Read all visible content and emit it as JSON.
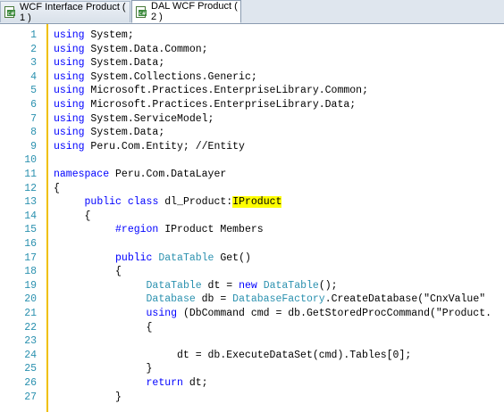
{
  "tabs": [
    {
      "label": "WCF Interface Product ( 1 )"
    },
    {
      "label": "DAL WCF Product ( 2 )"
    }
  ],
  "colors": {
    "keyword": "#0000ff",
    "type": "#2b91af",
    "highlight": "#ffff00",
    "line_number": "#2b91af",
    "margin": "#f0c000"
  },
  "lines": [
    {
      "num": "1",
      "t": [
        {
          "k": "kw",
          "s": "using"
        },
        {
          "s": " System;"
        }
      ]
    },
    {
      "num": "2",
      "t": [
        {
          "k": "kw",
          "s": "using"
        },
        {
          "s": " System.Data.Common;"
        }
      ]
    },
    {
      "num": "3",
      "t": [
        {
          "k": "kw",
          "s": "using"
        },
        {
          "s": " System.Data;"
        }
      ]
    },
    {
      "num": "4",
      "t": [
        {
          "k": "kw",
          "s": "using"
        },
        {
          "s": " System.Collections.Generic;"
        }
      ]
    },
    {
      "num": "5",
      "t": [
        {
          "k": "kw",
          "s": "using"
        },
        {
          "s": " Microsoft.Practices.EnterpriseLibrary.Common;"
        }
      ]
    },
    {
      "num": "6",
      "t": [
        {
          "k": "kw",
          "s": "using"
        },
        {
          "s": " Microsoft.Practices.EnterpriseLibrary.Data;"
        }
      ]
    },
    {
      "num": "7",
      "t": [
        {
          "k": "kw",
          "s": "using"
        },
        {
          "s": " System.ServiceModel;"
        }
      ]
    },
    {
      "num": "8",
      "t": [
        {
          "k": "kw",
          "s": "using"
        },
        {
          "s": " System.Data;"
        }
      ]
    },
    {
      "num": "9",
      "t": [
        {
          "k": "kw",
          "s": "using"
        },
        {
          "s": " Peru.Com.Entity; //Entity"
        }
      ]
    },
    {
      "num": "10",
      "t": []
    },
    {
      "num": "11",
      "t": [
        {
          "k": "kw",
          "s": "namespace"
        },
        {
          "s": " Peru.Com.DataLayer"
        }
      ]
    },
    {
      "num": "12",
      "t": [
        {
          "s": "{"
        }
      ]
    },
    {
      "num": "13",
      "t": [
        {
          "s": "     "
        },
        {
          "k": "kw",
          "s": "public"
        },
        {
          "s": " "
        },
        {
          "k": "kw",
          "s": "class"
        },
        {
          "s": " dl_Product:"
        },
        {
          "k": "hl",
          "s": "IProduct"
        }
      ]
    },
    {
      "num": "14",
      "t": [
        {
          "s": "     {"
        }
      ]
    },
    {
      "num": "15",
      "t": [
        {
          "s": "          "
        },
        {
          "k": "kw",
          "s": "#region"
        },
        {
          "s": " IProduct Members"
        }
      ]
    },
    {
      "num": "16",
      "t": []
    },
    {
      "num": "17",
      "t": [
        {
          "s": "          "
        },
        {
          "k": "kw",
          "s": "public"
        },
        {
          "s": " "
        },
        {
          "k": "ty",
          "s": "DataTable"
        },
        {
          "s": " Get()"
        }
      ]
    },
    {
      "num": "18",
      "t": [
        {
          "s": "          {"
        }
      ]
    },
    {
      "num": "19",
      "t": [
        {
          "s": "               "
        },
        {
          "k": "ty",
          "s": "DataTable"
        },
        {
          "s": " dt = "
        },
        {
          "k": "kw",
          "s": "new"
        },
        {
          "s": " "
        },
        {
          "k": "ty",
          "s": "DataTable"
        },
        {
          "s": "();"
        }
      ]
    },
    {
      "num": "20",
      "t": [
        {
          "s": "               "
        },
        {
          "k": "ty",
          "s": "Database"
        },
        {
          "s": " db = "
        },
        {
          "k": "ty",
          "s": "DatabaseFactory"
        },
        {
          "s": ".CreateDatabase(\"CnxValue\""
        }
      ]
    },
    {
      "num": "21",
      "t": [
        {
          "s": "               "
        },
        {
          "k": "kw",
          "s": "using"
        },
        {
          "s": " (DbCommand cmd = db.GetStoredProcCommand(\"Product."
        }
      ]
    },
    {
      "num": "22",
      "t": [
        {
          "s": "               {"
        }
      ]
    },
    {
      "num": "23",
      "t": []
    },
    {
      "num": "24",
      "t": [
        {
          "s": "                    dt = db.ExecuteDataSet(cmd).Tables[0];"
        }
      ]
    },
    {
      "num": "25",
      "t": [
        {
          "s": "               }"
        }
      ]
    },
    {
      "num": "26",
      "t": [
        {
          "s": "               "
        },
        {
          "k": "kw",
          "s": "return"
        },
        {
          "s": " dt;"
        }
      ]
    },
    {
      "num": "27",
      "t": [
        {
          "s": "          }"
        }
      ]
    }
  ]
}
